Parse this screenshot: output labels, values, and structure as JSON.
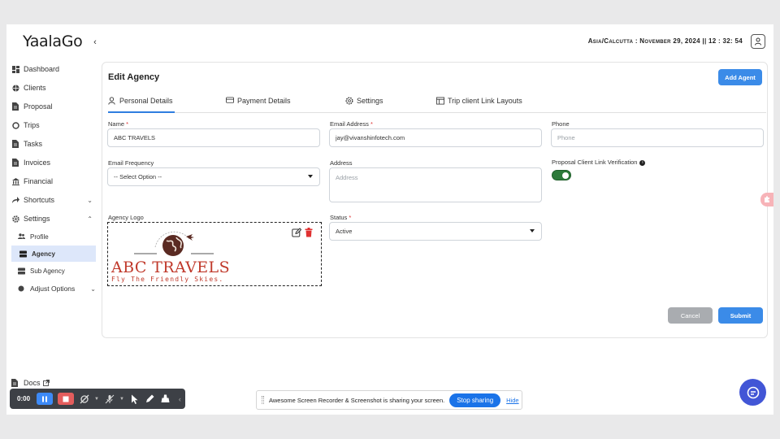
{
  "app": {
    "brand": "YaalaGo",
    "datetime": "Asia/Calcutta : November 29, 2024 || 12 : 32: 54"
  },
  "sidebar": {
    "items": [
      {
        "label": "Dashboard",
        "icon": "dashboard-icon"
      },
      {
        "label": "Clients",
        "icon": "globe-icon"
      },
      {
        "label": "Proposal",
        "icon": "document-icon"
      },
      {
        "label": "Trips",
        "icon": "circle-icon"
      },
      {
        "label": "Tasks",
        "icon": "document-icon"
      },
      {
        "label": "Invoices",
        "icon": "document-icon"
      },
      {
        "label": "Financial",
        "icon": "bank-icon"
      },
      {
        "label": "Shortcuts",
        "icon": "share-icon"
      },
      {
        "label": "Settings",
        "icon": "gear-icon"
      }
    ],
    "sub_items": [
      {
        "label": "Profile"
      },
      {
        "label": "Agency"
      },
      {
        "label": "Sub Agency"
      },
      {
        "label": "Adjust Options"
      }
    ],
    "docs_label": "Docs"
  },
  "page": {
    "title": "Edit Agency",
    "add_agent_label": "Add Agent",
    "tabs": [
      {
        "label": "Personal Details"
      },
      {
        "label": "Payment Details"
      },
      {
        "label": "Settings"
      },
      {
        "label": "Trip client Link Layouts"
      }
    ]
  },
  "form": {
    "name": {
      "label": "Name",
      "value": "ABC TRAVELS"
    },
    "email": {
      "label": "Email Address",
      "value": "jay@vivanshinfotech.com"
    },
    "phone": {
      "label": "Phone",
      "placeholder": "Phone"
    },
    "email_frequency": {
      "label": "Email Frequency",
      "value": "-- Select Option --"
    },
    "address": {
      "label": "Address",
      "placeholder": "Address"
    },
    "verification": {
      "label": "Proposal Client Link Verification",
      "enabled": true
    },
    "logo": {
      "label": "Agency Logo",
      "logo_text": "ABC TRAVELS",
      "logo_tagline": "Fly The Friendly Skies."
    },
    "status": {
      "label": "Status",
      "value": "Active"
    },
    "required_mark": "*",
    "cancel_label": "Cancel",
    "submit_label": "Submit"
  },
  "recorder": {
    "time": "0:00"
  },
  "share_bar": {
    "message": "Awesome Screen Recorder & Screenshot is sharing your screen.",
    "stop_label": "Stop sharing",
    "hide_label": "Hide"
  },
  "colors": {
    "primary": "#3b8be8",
    "toggle_on": "#2d7a3a",
    "logo_red": "#c0392b",
    "chat": "#4256d6"
  }
}
